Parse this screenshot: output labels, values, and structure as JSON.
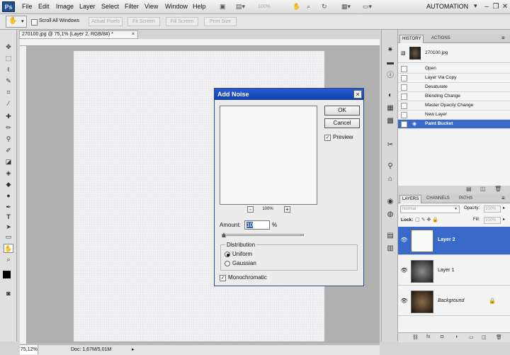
{
  "app": {
    "logo": "Ps",
    "workspace": "AUTOMATION",
    "zoom_level": "100%"
  },
  "menu": [
    "File",
    "Edit",
    "Image",
    "Layer",
    "Select",
    "Filter",
    "View",
    "Window",
    "Help"
  ],
  "options_bar": {
    "scroll_all_windows": "Scroll All Windows",
    "buttons": [
      "Actual Pixels",
      "Fit Screen",
      "Fill Screen",
      "Print Size"
    ]
  },
  "document": {
    "tab_title": "270100.jpg @ 75,1% (Layer 2, RGB/8#) *",
    "status_zoom": "75,12%",
    "status_doc": "Doc: 1,67M/5,01M"
  },
  "history": {
    "tabs": [
      "HISTORY",
      "ACTIONS"
    ],
    "snapshot": "270100.jpg",
    "items": [
      "Open",
      "Layer Via Copy",
      "Desaturate",
      "Blending Change",
      "Master Opacity Change",
      "New Layer",
      "Paint Bucket"
    ],
    "selected_index": 6
  },
  "layers": {
    "tabs": [
      "LAYERS",
      "CHANNELS",
      "PATHS"
    ],
    "blend_mode": "Normal",
    "opacity_label": "Opacity:",
    "opacity_value": "100%",
    "lock_label": "Lock:",
    "fill_label": "Fill:",
    "fill_value": "100%",
    "items": [
      {
        "name": "Layer 2"
      },
      {
        "name": "Layer 1"
      },
      {
        "name": "Background"
      }
    ],
    "selected_index": 0
  },
  "dialog": {
    "title": "Add Noise",
    "ok": "OK",
    "cancel": "Cancel",
    "preview": "Preview",
    "zoom": "100%",
    "amount_label": "Amount:",
    "amount_value": "10",
    "amount_unit": "%",
    "distribution_label": "Distribution",
    "uniform": "Uniform",
    "gaussian": "Gaussian",
    "monochromatic": "Monochromatic",
    "distribution_selected": "Uniform",
    "preview_checked": true,
    "monochromatic_checked": true
  },
  "colors": {
    "accent": "#3a6ac9",
    "title_bar": "#1b4dc0"
  }
}
